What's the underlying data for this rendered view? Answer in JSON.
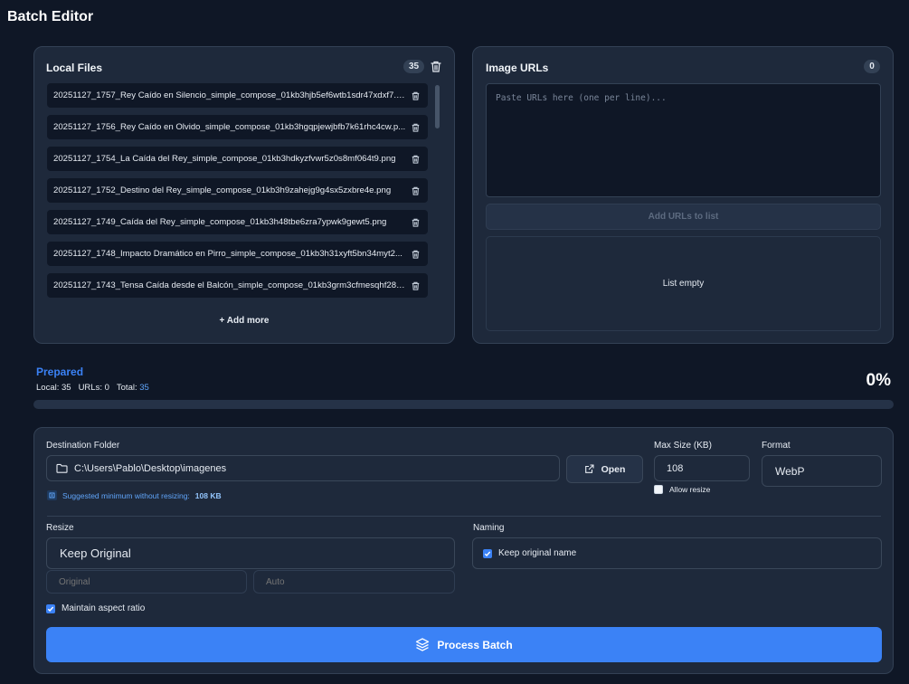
{
  "app": {
    "title": "Batch Editor"
  },
  "local_files": {
    "title": "Local Files",
    "count": "35",
    "files": [
      "20251127_1757_Rey Caído en Silencio_simple_compose_01kb3hjb5ef6wtb1sdr47xdxf7.p...",
      "20251127_1756_Rey Caído en Olvido_simple_compose_01kb3hgqpjewjbfb7k61rhc4cw.p...",
      "20251127_1754_La Caída del Rey_simple_compose_01kb3hdkyzfvwr5z0s8mf064t9.png",
      "20251127_1752_Destino del Rey_simple_compose_01kb3h9zahejg9g4sx5zxbre4e.png",
      "20251127_1749_Caída del Rey_simple_compose_01kb3h48tbe6zra7ypwk9gewt5.png",
      "20251127_1748_Impacto Dramático en Pirro_simple_compose_01kb3h31xyft5bn34myt2...",
      "20251127_1743_Tensa Caída desde el Balcón_simple_compose_01kb3grm3cfmesqhf28v..."
    ],
    "add_more": "+ Add more"
  },
  "image_urls": {
    "title": "Image URLs",
    "count": "0",
    "placeholder": "Paste URLs here (one per line)...",
    "add_button": "Add URLs to list",
    "empty_text": "List empty"
  },
  "progress": {
    "status": "Prepared",
    "local_label": "Local: 35",
    "urls_label": "URLs: 0",
    "total_label": "Total:",
    "total_value": "35",
    "percent_text": "0%",
    "fraction": 0
  },
  "settings": {
    "destination_label": "Destination Folder",
    "destination_value": "C:\\Users\\Pablo\\Desktop\\imagenes",
    "open_button": "Open",
    "hint_text": "Suggested minimum without resizing:",
    "hint_value": "108 KB",
    "max_size_label": "Max Size (KB)",
    "max_size_value": "108",
    "allow_resize_label": "Allow resize",
    "allow_resize_checked": false,
    "format_label": "Format",
    "format_value": "WebP",
    "resize_label": "Resize",
    "resize_value": "Keep Original",
    "width_placeholder": "Original",
    "height_placeholder": "Auto",
    "maintain_aspect_label": "Maintain aspect ratio",
    "maintain_aspect_checked": true,
    "naming_label": "Naming",
    "keep_name_label": "Keep original name",
    "keep_name_checked": true,
    "process_button": "Process Batch"
  },
  "colors": {
    "accent": "#3b82f6",
    "background": "#0f1726",
    "panel": "#1e293b"
  }
}
